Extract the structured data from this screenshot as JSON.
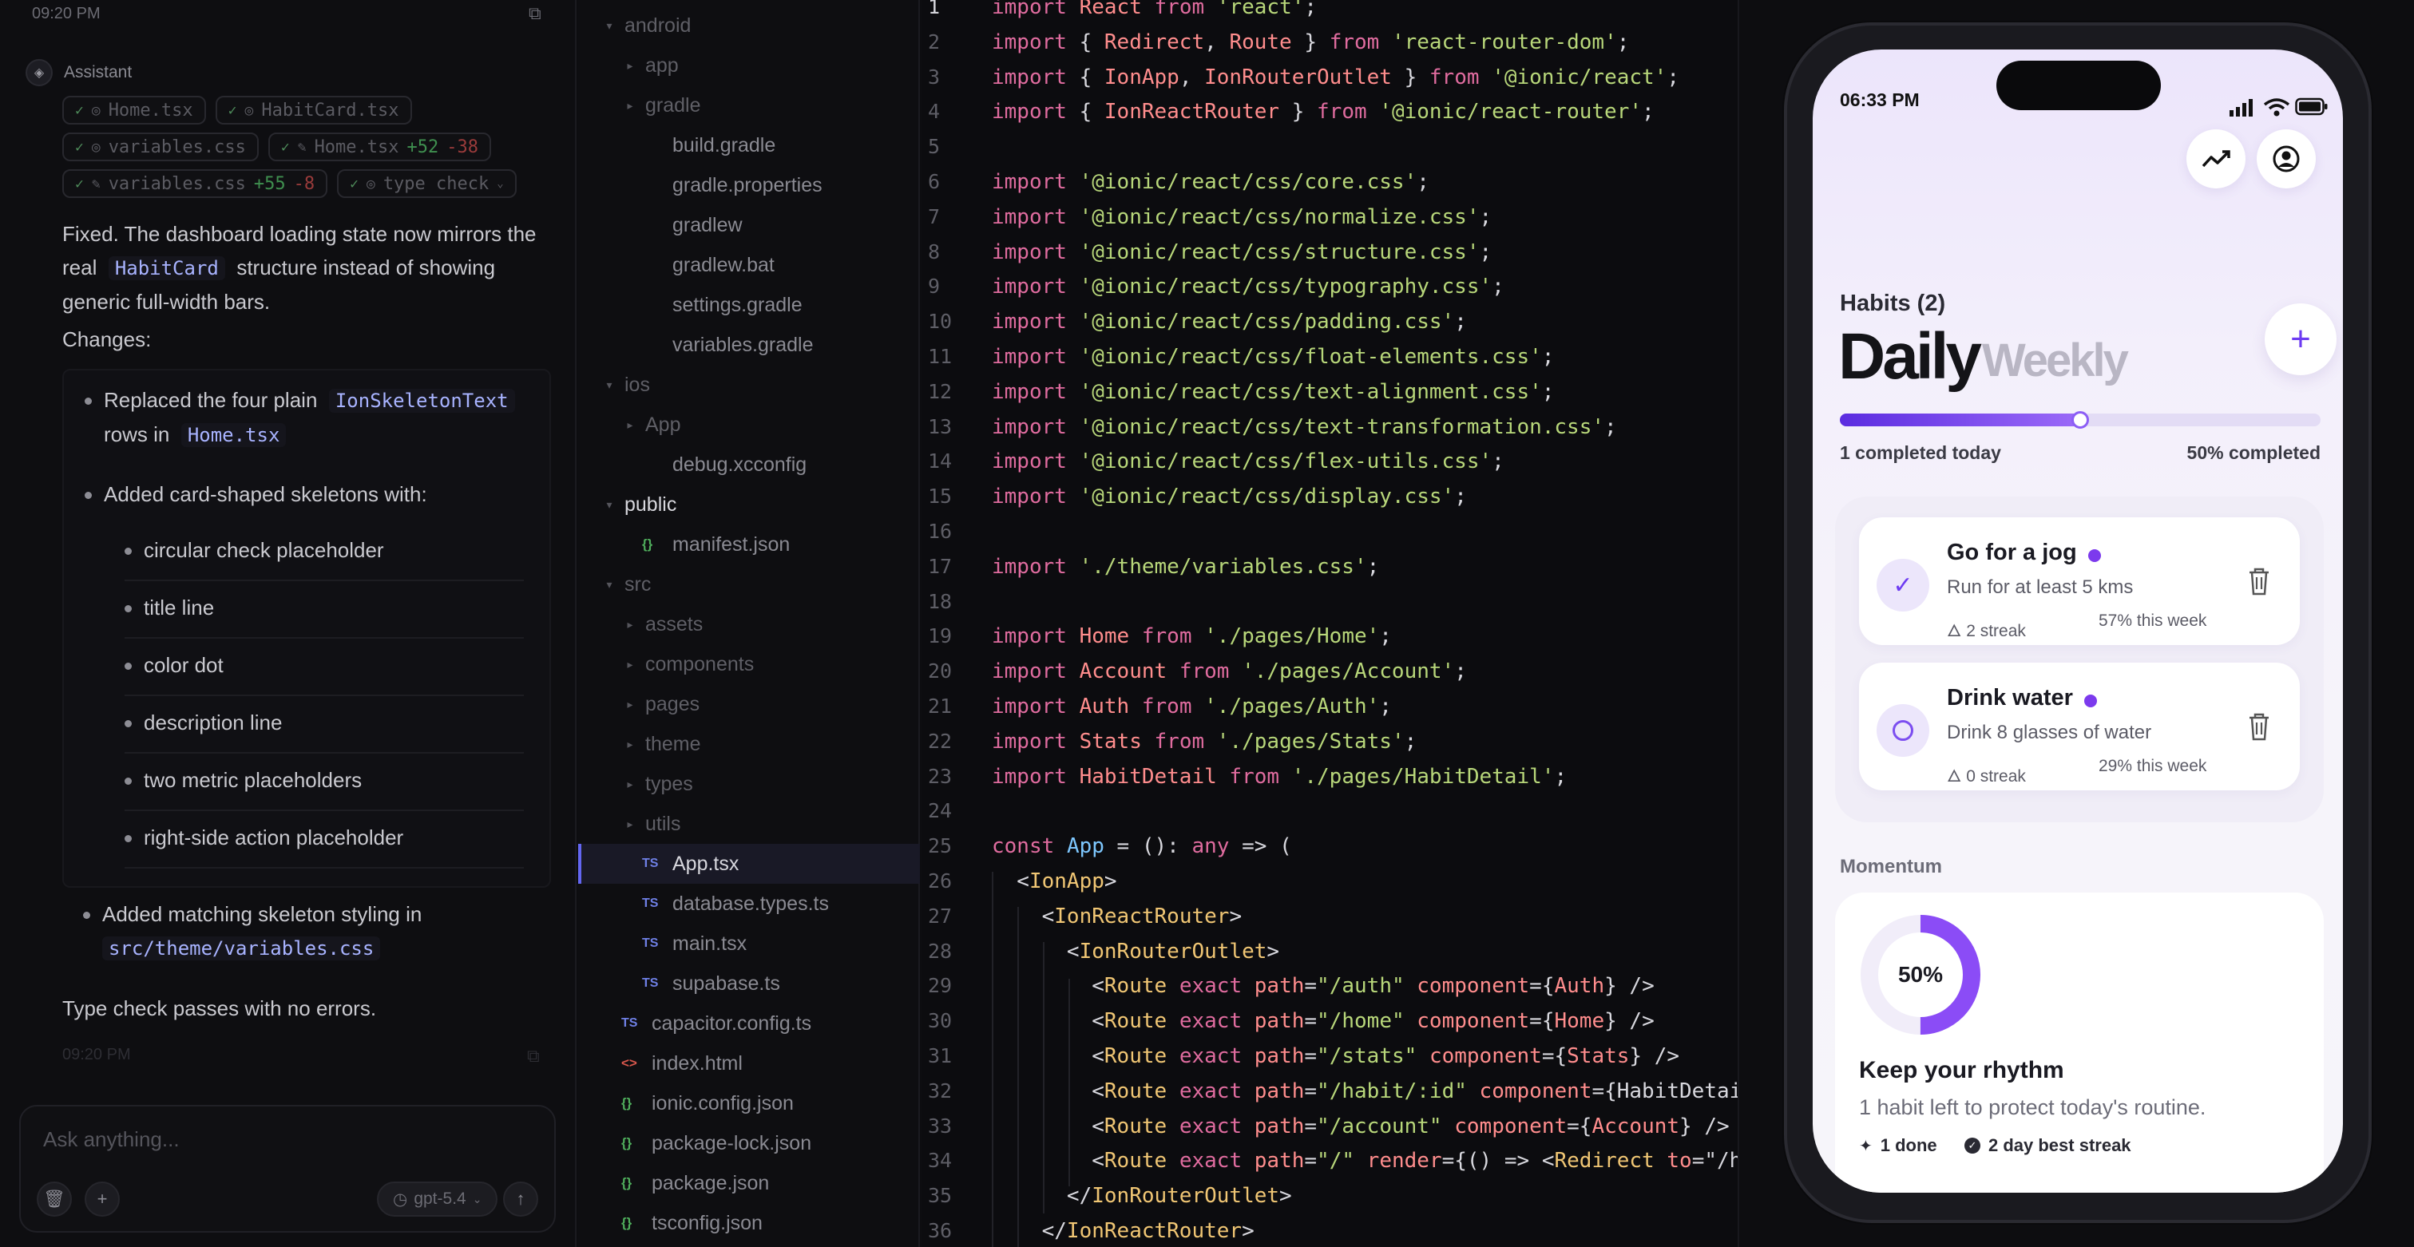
{
  "chat": {
    "timestamp_top": "09:20 PM",
    "assistant_label": "Assistant",
    "chips": [
      [
        {
          "label": "Home.tsx"
        },
        {
          "label": "HabitCard.tsx"
        }
      ],
      [
        {
          "label": "variables.css"
        },
        {
          "label": "Home.tsx",
          "add": "+52",
          "del": "-38"
        }
      ],
      [
        {
          "label": "variables.css",
          "add": "+55",
          "del": "-8"
        },
        {
          "label": "type check"
        }
      ]
    ],
    "message_pre": "Fixed. The dashboard loading state now mirrors the",
    "message_real": "real",
    "message_code": "HabitCard",
    "message_post": "structure instead of showing",
    "message_line3": "generic full-width bars.",
    "changes_label": "Changes:",
    "bullet1_pre": "Replaced the four plain",
    "bullet1_code": "IonSkeletonText",
    "bullet1_rows": "rows in",
    "bullet1_file": "Home.tsx",
    "bullet2": "Added card-shaped skeletons with:",
    "sub_items": [
      "circular check placeholder",
      "title line",
      "color dot",
      "description line",
      "two metric placeholders",
      "right-side action placeholder"
    ],
    "bullet3": "Added matching skeleton styling in",
    "bullet3_file": "src/theme/variables.css",
    "type_check": "Type check passes with no errors.",
    "timestamp_bottom": "09:20 PM",
    "input_placeholder": "Ask anything...",
    "model": "gpt-5.4"
  },
  "tree": [
    {
      "name": "android",
      "indent": 0,
      "kind": "folder",
      "open": true,
      "tone": "dim"
    },
    {
      "name": "app",
      "indent": 1,
      "kind": "folder",
      "tone": "dim"
    },
    {
      "name": "gradle",
      "indent": 1,
      "kind": "folder",
      "tone": "dim"
    },
    {
      "name": "build.gradle",
      "indent": 2,
      "kind": "file",
      "tone": "mid"
    },
    {
      "name": "gradle.properties",
      "indent": 2,
      "kind": "file",
      "tone": "mid"
    },
    {
      "name": "gradlew",
      "indent": 2,
      "kind": "file",
      "tone": "mid"
    },
    {
      "name": "gradlew.bat",
      "indent": 2,
      "kind": "file",
      "tone": "mid"
    },
    {
      "name": "settings.gradle",
      "indent": 2,
      "kind": "file",
      "tone": "mid"
    },
    {
      "name": "variables.gradle",
      "indent": 2,
      "kind": "file",
      "tone": "mid"
    },
    {
      "name": "ios",
      "indent": 0,
      "kind": "folder",
      "open": true,
      "tone": "dim"
    },
    {
      "name": "App",
      "indent": 1,
      "kind": "folder",
      "tone": "dim"
    },
    {
      "name": "debug.xcconfig",
      "indent": 2,
      "kind": "file",
      "tone": "mid"
    },
    {
      "name": "public",
      "indent": 0,
      "kind": "folder",
      "open": true,
      "tone": "bright"
    },
    {
      "name": "manifest.json",
      "indent": 2,
      "kind": "json",
      "tone": "mid"
    },
    {
      "name": "src",
      "indent": 0,
      "kind": "folder",
      "open": true,
      "tone": "dim"
    },
    {
      "name": "assets",
      "indent": 1,
      "kind": "folder",
      "tone": "dim"
    },
    {
      "name": "components",
      "indent": 1,
      "kind": "folder",
      "tone": "dim"
    },
    {
      "name": "pages",
      "indent": 1,
      "kind": "folder",
      "tone": "dim"
    },
    {
      "name": "theme",
      "indent": 1,
      "kind": "folder",
      "tone": "dim"
    },
    {
      "name": "types",
      "indent": 1,
      "kind": "folder",
      "tone": "dim"
    },
    {
      "name": "utils",
      "indent": 1,
      "kind": "folder",
      "tone": "dim"
    },
    {
      "name": "App.tsx",
      "indent": 2,
      "kind": "ts",
      "tone": "bright",
      "selected": true
    },
    {
      "name": "database.types.ts",
      "indent": 2,
      "kind": "ts",
      "tone": "mid"
    },
    {
      "name": "main.tsx",
      "indent": 2,
      "kind": "ts",
      "tone": "mid"
    },
    {
      "name": "supabase.ts",
      "indent": 2,
      "kind": "ts",
      "tone": "mid"
    },
    {
      "name": "capacitor.config.ts",
      "indent": 1,
      "kind": "ts",
      "tone": "mid"
    },
    {
      "name": "index.html",
      "indent": 1,
      "kind": "html",
      "tone": "mid"
    },
    {
      "name": "ionic.config.json",
      "indent": 1,
      "kind": "json",
      "tone": "mid"
    },
    {
      "name": "package-lock.json",
      "indent": 1,
      "kind": "json",
      "tone": "mid"
    },
    {
      "name": "package.json",
      "indent": 1,
      "kind": "json",
      "tone": "mid"
    },
    {
      "name": "tsconfig.json",
      "indent": 1,
      "kind": "json",
      "tone": "mid"
    }
  ],
  "icons": {
    "ts": "TS",
    "json": "{}",
    "html": "<>"
  },
  "editor": {
    "current_line": 1,
    "lines": [
      "import React from 'react';",
      "import { Redirect, Route } from 'react-router-dom';",
      "import { IonApp, IonRouterOutlet } from '@ionic/react';",
      "import { IonReactRouter } from '@ionic/react-router';",
      "",
      "import '@ionic/react/css/core.css';",
      "import '@ionic/react/css/normalize.css';",
      "import '@ionic/react/css/structure.css';",
      "import '@ionic/react/css/typography.css';",
      "import '@ionic/react/css/padding.css';",
      "import '@ionic/react/css/float-elements.css';",
      "import '@ionic/react/css/text-alignment.css';",
      "import '@ionic/react/css/text-transformation.css';",
      "import '@ionic/react/css/flex-utils.css';",
      "import '@ionic/react/css/display.css';",
      "",
      "import './theme/variables.css';",
      "",
      "import Home from './pages/Home';",
      "import Account from './pages/Account';",
      "import Auth from './pages/Auth';",
      "import Stats from './pages/Stats';",
      "import HabitDetail from './pages/HabitDetail';",
      "",
      "const App = (): any => (",
      "  <IonApp>",
      "    <IonReactRouter>",
      "      <IonRouterOutlet>",
      "        <Route exact path=\"/auth\" component={Auth} />",
      "        <Route exact path=\"/home\" component={Home} />",
      "        <Route exact path=\"/stats\" component={Stats} />",
      "        <Route exact path=\"/habit/:id\" component={HabitDetai",
      "        <Route exact path=\"/account\" component={Account} />",
      "        <Route exact path=\"/\" render={() => <Redirect to=\"/h",
      "      </IonRouterOutlet>",
      "    </IonReactRouter>"
    ]
  },
  "phone": {
    "time": "06:33 PM",
    "habits_title": "Habits (2)",
    "tab_daily": "Daily",
    "tab_weekly": "Weekly",
    "progress_fraction": 0.5,
    "completed_today": "1 completed today",
    "completed_pct": "50% completed",
    "habits": [
      {
        "title": "Go for a jog",
        "desc": "Run for at least 5 kms",
        "streak": "2 streak",
        "week": "57% this week",
        "done": true
      },
      {
        "title": "Drink water",
        "desc": "Drink 8 glasses of water",
        "streak": "0 streak",
        "week": "29% this week",
        "done": false
      }
    ],
    "momentum_label": "Momentum",
    "momentum_pct_value": 0.5,
    "momentum_pct": "50%",
    "momentum_title": "Keep your rhythm",
    "momentum_sub": "1 habit left to protect today's routine.",
    "stat_done": "1 done",
    "stat_streak": "2 day best streak",
    "accent": "#6d3bf2"
  }
}
